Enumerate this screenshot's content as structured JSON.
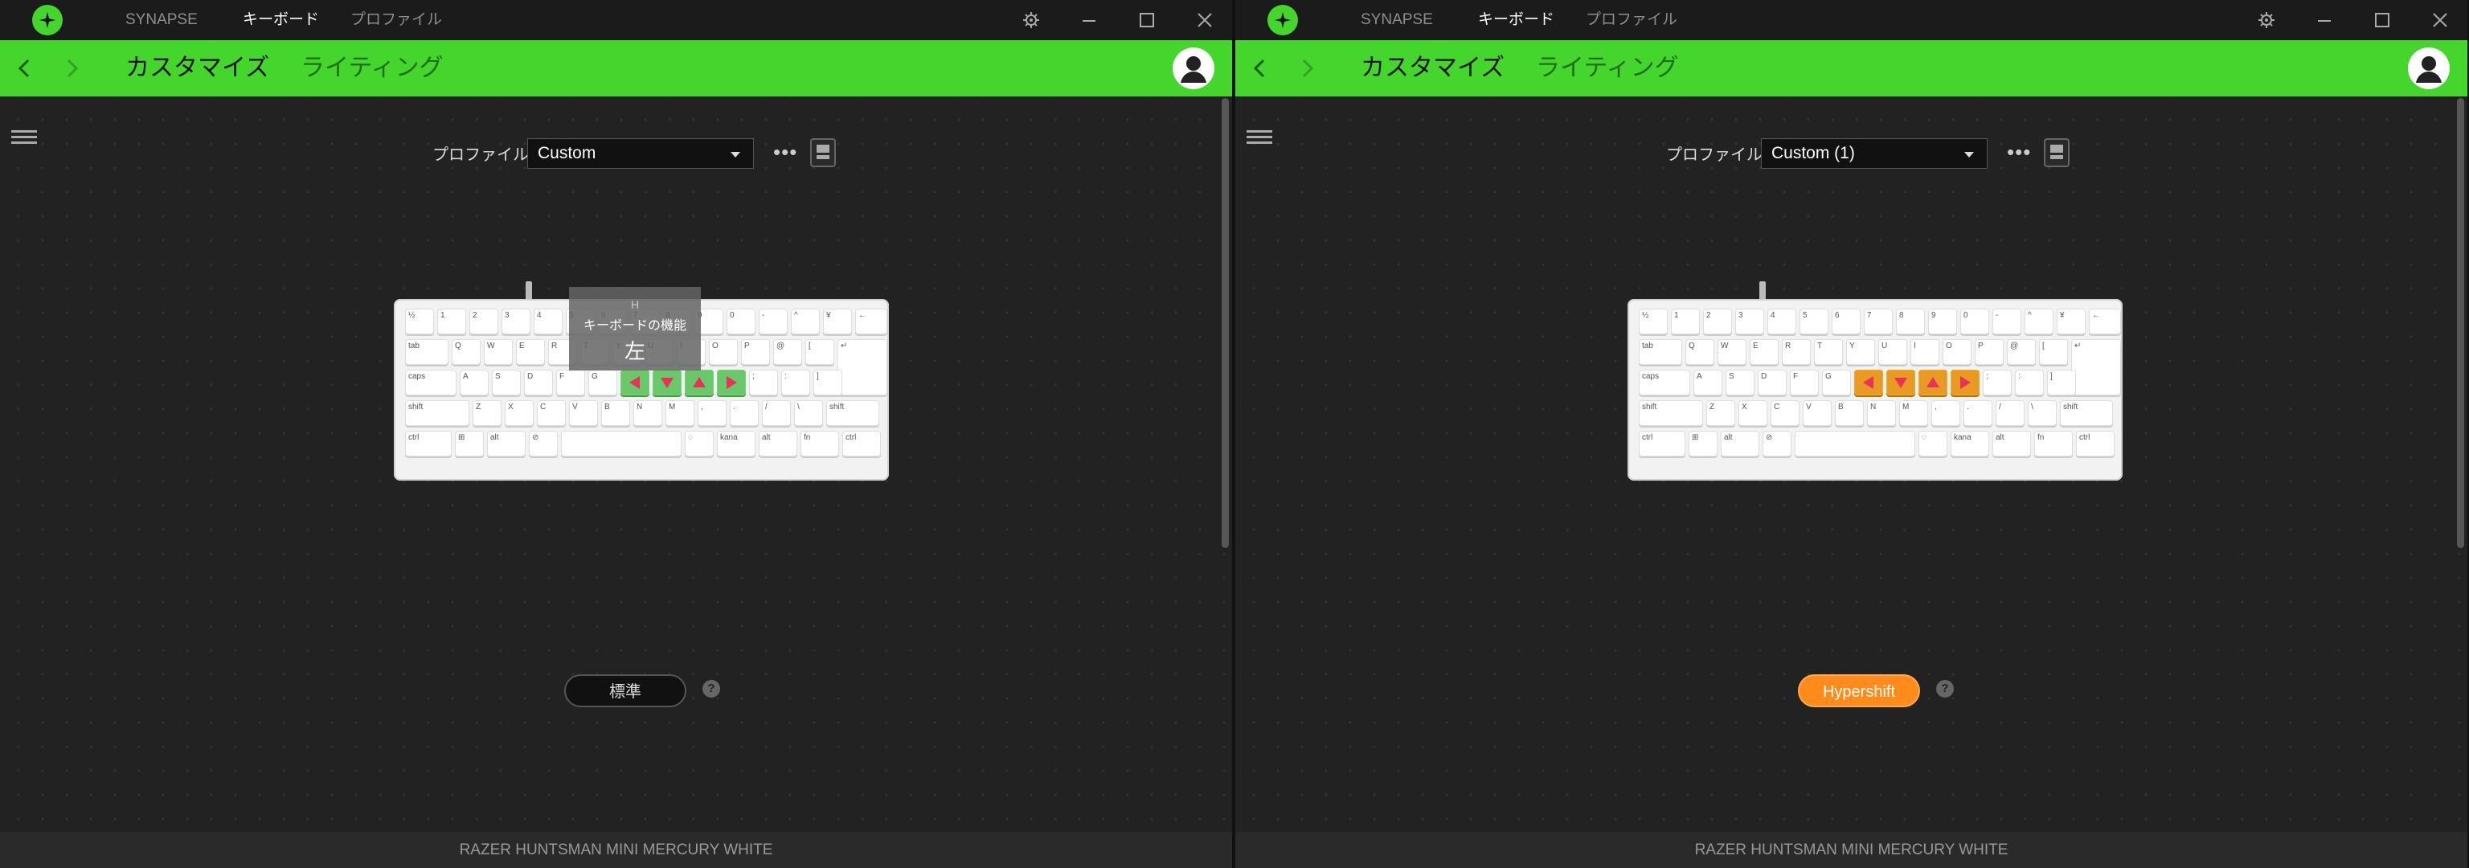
{
  "windows": [
    {
      "nav": {
        "synapse": "SYNAPSE",
        "keyboard": "キーボード",
        "profile": "プロファイル"
      },
      "subnav": {
        "customize": "カスタマイズ",
        "lighting": "ライティング"
      },
      "profile": {
        "label": "プロファイル",
        "value": "Custom"
      },
      "mode_label": "標準",
      "help": "?",
      "tooltip": {
        "key": "H",
        "caption": "キーボードの機能",
        "value": "左"
      },
      "footer": "RAZER HUNTSMAN MINI MERCURY WHITE"
    },
    {
      "nav": {
        "synapse": "SYNAPSE",
        "keyboard": "キーボード",
        "profile": "プロファイル"
      },
      "subnav": {
        "customize": "カスタマイズ",
        "lighting": "ライティング"
      },
      "profile": {
        "label": "プロファイル",
        "value": "Custom (1)"
      },
      "mode_label": "Hypershift",
      "help": "?",
      "footer": "RAZER HUNTSMAN MINI MERCURY WHITE"
    }
  ],
  "keys": {
    "row1": [
      "½",
      "1",
      "2",
      "3",
      "4",
      "5",
      "6",
      "7",
      "8",
      "9",
      "0",
      "-",
      "^",
      "¥",
      "←"
    ],
    "row2": [
      "tab",
      "Q",
      "W",
      "E",
      "R",
      "T",
      "Y",
      "U",
      "I",
      "O",
      "P",
      "@",
      "[",
      "↵"
    ],
    "row3": [
      "caps",
      "A",
      "S",
      "D",
      "F",
      "G",
      "",
      "",
      "",
      "",
      ";",
      ":",
      "]"
    ],
    "row4": [
      "shift",
      "Z",
      "X",
      "C",
      "V",
      "B",
      "N",
      "M",
      ",",
      ".",
      "/",
      "\\",
      "shift"
    ],
    "row5": [
      "ctrl",
      "⊞",
      "alt",
      "⊘",
      "",
      "◌",
      "kana",
      "alt",
      "fn",
      "ctrl"
    ]
  },
  "colors": {
    "accent": "#44d62c",
    "assigned_standard": "#6ac86a",
    "assigned_hypershift": "#e89a22",
    "arrow": "#e8325a"
  },
  "icons": [
    "razer-logo-icon",
    "gear-icon",
    "minimize-icon",
    "maximize-icon",
    "close-icon",
    "back-arrow-icon",
    "forward-arrow-icon",
    "user-avatar-icon",
    "hamburger-menu-icon",
    "more-options-icon",
    "onboard-memory-icon",
    "help-icon",
    "arrow-left-icon",
    "arrow-down-icon",
    "arrow-up-icon",
    "arrow-right-icon"
  ]
}
